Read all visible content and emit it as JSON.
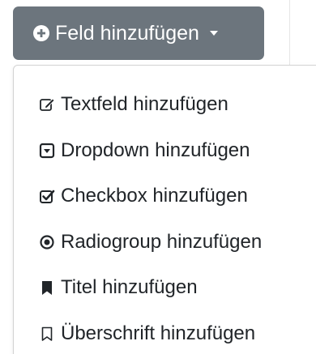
{
  "button": {
    "label": "Feld hinzufügen",
    "icon": "plus-circle-icon",
    "caret_icon": "caret-down-icon",
    "background": "#6c757d",
    "text_color": "#ffffff"
  },
  "menu": {
    "items": [
      {
        "label": "Textfeld hinzufügen",
        "icon": "edit-square-icon"
      },
      {
        "label": "Dropdown hinzufügen",
        "icon": "caret-square-down-icon"
      },
      {
        "label": "Checkbox hinzufügen",
        "icon": "check-square-icon"
      },
      {
        "label": "Radiogroup hinzufügen",
        "icon": "dot-circle-icon"
      },
      {
        "label": "Titel hinzufügen",
        "icon": "bookmark-filled-icon"
      },
      {
        "label": "Überschrift hinzufügen",
        "icon": "bookmark-outline-icon"
      }
    ]
  }
}
